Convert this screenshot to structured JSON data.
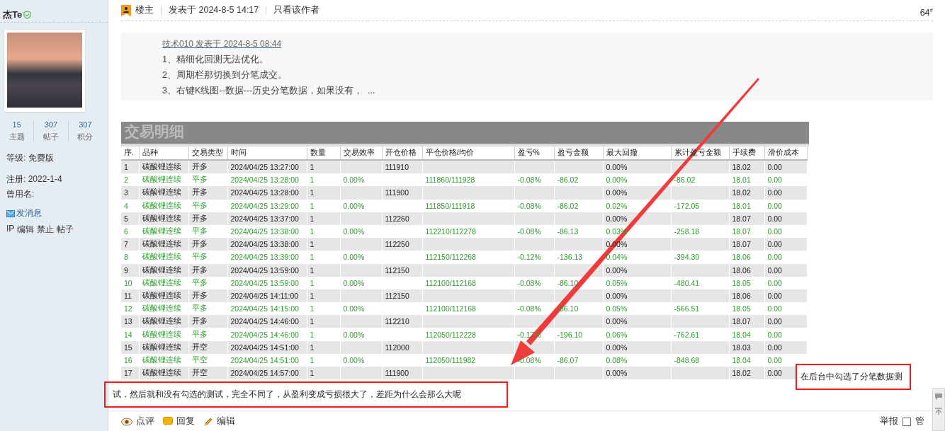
{
  "sidebar": {
    "username": "杰Te",
    "stats": [
      {
        "value": "15",
        "label": "主题"
      },
      {
        "value": "307",
        "label": "帖子"
      },
      {
        "value": "307",
        "label": "积分"
      }
    ],
    "info": [
      "等级: 免费版",
      "注册: 2022-1-4",
      "曾用名:"
    ],
    "send_message": "发消息",
    "admin_links": [
      "IP",
      "编辑",
      "禁止",
      "帖子"
    ]
  },
  "post": {
    "role": "楼主",
    "posted": "发表于 2024-8-5 14:17",
    "author_only": "只看该作者",
    "floor": "64$^{#}$"
  },
  "quote": {
    "byline": "技术010 发表于 2024-8-5 08:44",
    "lines": [
      "1、精细化回测无法优化。",
      "2、周期栏那切换到分笔成交。",
      "3、右键K线图--数据---历史分笔数据，如果没有，  ..."
    ]
  },
  "trade_table": {
    "title": "交易明细",
    "columns": [
      "序.",
      "品种",
      "交易类型",
      "时间",
      "数量",
      "交易效率",
      "开仓价格",
      "平仓价格/均价",
      "盈亏%",
      "盈亏金额",
      "最大回撤",
      "累计盈亏金额",
      "手续费",
      "滑价成本"
    ],
    "rows": [
      {
        "kind": "open",
        "cells": [
          "1",
          "碳酸锂连续",
          "开多",
          "2024/04/25 13:27:00",
          "1",
          null,
          "111910",
          null,
          null,
          null,
          "0.00%",
          null,
          "18.02",
          "0.00"
        ]
      },
      {
        "kind": "close",
        "cells": [
          "2",
          "碳酸锂连续",
          "平多",
          "2024/04/25 13:28:00",
          "1",
          "0.00%",
          null,
          "111860/111928",
          "-0.08%",
          "-86.02",
          "0.00%",
          "-86.02",
          "18.01",
          "0.00"
        ]
      },
      {
        "kind": "open",
        "cells": [
          "3",
          "碳酸锂连续",
          "开多",
          "2024/04/25 13:28:00",
          "1",
          null,
          "111900",
          null,
          null,
          null,
          "0.00%",
          null,
          "18.02",
          "0.00"
        ]
      },
      {
        "kind": "close",
        "cells": [
          "4",
          "碳酸锂连续",
          "平多",
          "2024/04/25 13:29:00",
          "1",
          "0.00%",
          null,
          "111850/111918",
          "-0.08%",
          "-86.02",
          "0.02%",
          "-172.05",
          "18.01",
          "0.00"
        ]
      },
      {
        "kind": "open",
        "cells": [
          "5",
          "碳酸锂连续",
          "开多",
          "2024/04/25 13:37:00",
          "1",
          null,
          "112260",
          null,
          null,
          null,
          "0.00%",
          null,
          "18.07",
          "0.00"
        ]
      },
      {
        "kind": "close",
        "cells": [
          "6",
          "碳酸锂连续",
          "平多",
          "2024/04/25 13:38:00",
          "1",
          "0.00%",
          null,
          "112210/112278",
          "-0.08%",
          "-86.13",
          "0.03%",
          "-258.18",
          "18.07",
          "0.00"
        ]
      },
      {
        "kind": "open",
        "cells": [
          "7",
          "碳酸锂连续",
          "开多",
          "2024/04/25 13:38:00",
          "1",
          null,
          "112250",
          null,
          null,
          null,
          "0.00%",
          null,
          "18.07",
          "0.00"
        ]
      },
      {
        "kind": "close",
        "cells": [
          "8",
          "碳酸锂连续",
          "平多",
          "2024/04/25 13:39:00",
          "1",
          "0.00%",
          null,
          "112150/112268",
          "-0.12%",
          "-136.13",
          "0.04%",
          "-394.30",
          "18.06",
          "0.00"
        ]
      },
      {
        "kind": "open",
        "cells": [
          "9",
          "碳酸锂连续",
          "开多",
          "2024/04/25 13:59:00",
          "1",
          null,
          "112150",
          null,
          null,
          null,
          "0.00%",
          null,
          "18.06",
          "0.00"
        ]
      },
      {
        "kind": "close",
        "cells": [
          "10",
          "碳酸锂连续",
          "平多",
          "2024/04/25 13:59:00",
          "1",
          "0.00%",
          null,
          "112100/112168",
          "-0.08%",
          "-86.10",
          "0.05%",
          "-480.41",
          "18.05",
          "0.00"
        ]
      },
      {
        "kind": "open",
        "cells": [
          "11",
          "碳酸锂连续",
          "开多",
          "2024/04/25 14:11:00",
          "1",
          null,
          "112150",
          null,
          null,
          null,
          "0.00%",
          null,
          "18.06",
          "0.00"
        ]
      },
      {
        "kind": "close",
        "cells": [
          "12",
          "碳酸锂连续",
          "平多",
          "2024/04/25 14:15:00",
          "1",
          "0.00%",
          null,
          "112100/112168",
          "-0.08%",
          "-86.10",
          "0.05%",
          "-566.51",
          "18.05",
          "0.00"
        ]
      },
      {
        "kind": "open",
        "cells": [
          "13",
          "碳酸锂连续",
          "开多",
          "2024/04/25 14:46:00",
          "1",
          null,
          "112210",
          null,
          null,
          null,
          "0.00%",
          null,
          "18.07",
          "0.00"
        ]
      },
      {
        "kind": "close",
        "cells": [
          "14",
          "碳酸锂连续",
          "平多",
          "2024/04/25 14:46:00",
          "1",
          "0.00%",
          null,
          "112050/112228",
          "-0.17%",
          "-196.10",
          "0.06%",
          "-762.61",
          "18.04",
          "0.00"
        ]
      },
      {
        "kind": "open",
        "cells": [
          "15",
          "碳酸锂连续",
          "开空",
          "2024/04/25 14:51:00",
          "1",
          null,
          "112000",
          null,
          null,
          null,
          "0.00%",
          null,
          "18.03",
          "0.00"
        ]
      },
      {
        "kind": "close",
        "cells": [
          "16",
          "碳酸锂连续",
          "平空",
          "2024/04/25 14:51:00",
          "1",
          "0.00%",
          null,
          "112050/111982",
          "-0.08%",
          "-86.07",
          "0.08%",
          "-848.68",
          "18.04",
          "0.00"
        ]
      },
      {
        "kind": "open",
        "cells": [
          "17",
          "碳酸锂连续",
          "开空",
          "2024/04/25 14:57:00",
          "1",
          null,
          "111900",
          null,
          null,
          null,
          "0.00%",
          null,
          "18.02",
          "0.00"
        ]
      }
    ]
  },
  "note_right": "在后台中勾选了分笔数据测",
  "note_bottom": "试，然后就和没有勾选的测试，完全不同了，从盈利变成亏损很大了，差距为什么会那么大呢",
  "actions": [
    {
      "kind": "rate",
      "label": "点评"
    },
    {
      "kind": "reply",
      "label": "回复"
    },
    {
      "kind": "edit",
      "label": "编辑"
    }
  ],
  "report": "举报",
  "manage": {
    "label": "管",
    "checked": false
  }
}
